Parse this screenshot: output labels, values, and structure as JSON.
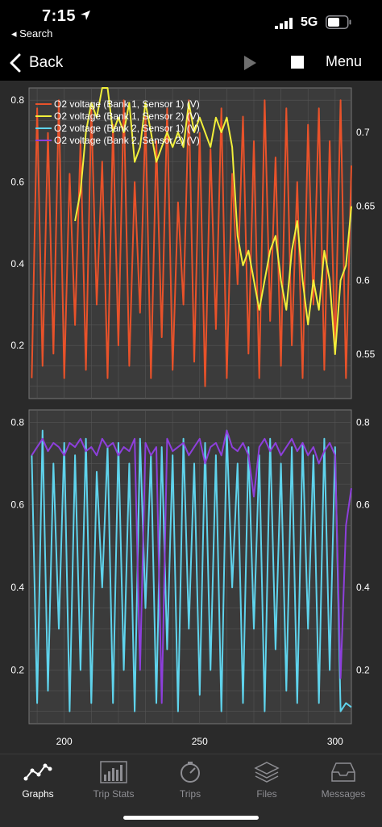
{
  "status_bar": {
    "time": "7:15",
    "back_app": "◂ Search",
    "network": "5G"
  },
  "nav": {
    "back_label": "Back",
    "menu_label": "Menu"
  },
  "colors": {
    "b1s1": "#e8522a",
    "b1s2": "#f1ef3a",
    "b2s1": "#5fd3ec",
    "b2s2": "#8d3fdb",
    "background": "#2a2a2a",
    "grid": "#555555"
  },
  "chart_data": [
    {
      "type": "line",
      "x_ticks": [
        "200",
        "250",
        "300"
      ],
      "xlim": [
        187,
        306
      ],
      "left_axis": {
        "ylim": [
          0.07,
          0.83
        ],
        "ticks": [
          "0.2",
          "0.4",
          "0.6",
          "0.8"
        ]
      },
      "right_axis": {
        "ylim": [
          0.52,
          0.73
        ],
        "ticks": [
          "0.55",
          "0.6",
          "0.65",
          "0.7"
        ]
      },
      "legend": [
        "O2 voltage (Bank 1, Sensor 1) (V)",
        "O2 voltage (Bank 1, Sensor 2) (V)",
        "O2 voltage (Bank 2, Sensor 1) (V)",
        "O2 voltage (Bank 2, Sensor 2) (V)"
      ],
      "series": [
        {
          "name": "O2 voltage (Bank 1, Sensor 1) (V)",
          "axis": "left",
          "x": [
            188,
            190,
            192,
            194,
            196,
            198,
            200,
            202,
            204,
            206,
            208,
            210,
            212,
            214,
            216,
            218,
            220,
            222,
            224,
            226,
            228,
            230,
            232,
            234,
            236,
            238,
            240,
            242,
            244,
            246,
            248,
            250,
            252,
            254,
            256,
            258,
            260,
            262,
            264,
            266,
            268,
            270,
            272,
            274,
            276,
            278,
            280,
            282,
            284,
            286,
            288,
            290,
            292,
            294,
            296,
            298,
            300,
            302,
            304,
            306
          ],
          "values": [
            0.12,
            0.78,
            0.15,
            0.72,
            0.18,
            0.8,
            0.12,
            0.62,
            0.25,
            0.7,
            0.14,
            0.78,
            0.3,
            0.65,
            0.12,
            0.74,
            0.2,
            0.8,
            0.15,
            0.6,
            0.28,
            0.76,
            0.12,
            0.7,
            0.22,
            0.78,
            0.14,
            0.55,
            0.3,
            0.8,
            0.16,
            0.72,
            0.1,
            0.68,
            0.24,
            0.78,
            0.12,
            0.62,
            0.35,
            0.76,
            0.18,
            0.7,
            0.12,
            0.8,
            0.26,
            0.66,
            0.15,
            0.78,
            0.2,
            0.6,
            0.12,
            0.74,
            0.3,
            0.78,
            0.14,
            0.7,
            0.18,
            0.8,
            0.12,
            0.64
          ]
        },
        {
          "name": "O2 voltage (Bank 1, Sensor 2) (V)",
          "axis": "right",
          "x": [
            204,
            206,
            208,
            210,
            212,
            214,
            216,
            218,
            220,
            222,
            224,
            226,
            228,
            230,
            232,
            234,
            236,
            238,
            240,
            242,
            244,
            246,
            248,
            250,
            252,
            254,
            256,
            258,
            260,
            262,
            264,
            266,
            268,
            270,
            272,
            274,
            276,
            278,
            280,
            282,
            284,
            286,
            288,
            290,
            292,
            294,
            296,
            298,
            300,
            302,
            304,
            306
          ],
          "values": [
            0.64,
            0.66,
            0.7,
            0.72,
            0.71,
            0.73,
            0.73,
            0.7,
            0.71,
            0.7,
            0.72,
            0.68,
            0.69,
            0.72,
            0.7,
            0.68,
            0.69,
            0.7,
            0.69,
            0.7,
            0.69,
            0.72,
            0.7,
            0.71,
            0.7,
            0.69,
            0.71,
            0.7,
            0.71,
            0.69,
            0.63,
            0.61,
            0.62,
            0.6,
            0.58,
            0.6,
            0.62,
            0.63,
            0.6,
            0.58,
            0.62,
            0.64,
            0.6,
            0.57,
            0.6,
            0.58,
            0.62,
            0.6,
            0.55,
            0.6,
            0.61,
            0.65
          ]
        },
        {
          "name": "O2 voltage (Bank 2, Sensor 1) (V)",
          "axis": "left",
          "x": [
            188,
            190,
            192,
            194,
            196,
            198,
            200,
            202,
            204,
            206,
            208,
            210,
            212,
            214,
            216,
            218,
            220,
            222,
            224,
            226,
            228,
            230,
            232,
            234,
            236,
            238,
            240,
            242,
            244,
            246,
            248,
            250,
            252,
            254,
            256,
            258,
            260,
            262,
            264,
            266,
            268,
            270,
            272,
            274,
            276,
            278,
            280,
            282,
            284,
            286,
            288,
            290,
            292,
            294,
            296,
            298,
            300,
            302,
            304,
            306
          ],
          "values": [
            0.72,
            0.12,
            0.78,
            0.15,
            0.7,
            0.3,
            0.75,
            0.1,
            0.72,
            0.2,
            0.76,
            0.12,
            0.68,
            0.4,
            0.74,
            0.12,
            0.75,
            0.2,
            0.7,
            0.1,
            0.76,
            0.35,
            0.72,
            0.12,
            0.74,
            0.25,
            0.72,
            0.1,
            0.76,
            0.3,
            0.7,
            0.14,
            0.75,
            0.2,
            0.72,
            0.1,
            0.78,
            0.4,
            0.7,
            0.12,
            0.74,
            0.3,
            0.72,
            0.1,
            0.76,
            0.25,
            0.7,
            0.15,
            0.74,
            0.12,
            0.75,
            0.3,
            0.72,
            0.12,
            0.76,
            0.2,
            0.74,
            0.1,
            0.12,
            0.11
          ]
        },
        {
          "name": "O2 voltage (Bank 2, Sensor 2) (V)",
          "axis": "left",
          "x": [
            188,
            190,
            192,
            194,
            196,
            198,
            200,
            202,
            204,
            206,
            208,
            210,
            212,
            214,
            216,
            218,
            220,
            222,
            224,
            226,
            228,
            230,
            232,
            234,
            236,
            238,
            240,
            242,
            244,
            246,
            248,
            250,
            252,
            254,
            256,
            258,
            260,
            262,
            264,
            266,
            268,
            270,
            272,
            274,
            276,
            278,
            280,
            282,
            284,
            286,
            288,
            290,
            292,
            294,
            296,
            298,
            300,
            302,
            304,
            306
          ],
          "values": [
            0.72,
            0.74,
            0.76,
            0.73,
            0.75,
            0.74,
            0.72,
            0.75,
            0.74,
            0.76,
            0.73,
            0.74,
            0.72,
            0.76,
            0.74,
            0.75,
            0.72,
            0.74,
            0.73,
            0.76,
            0.2,
            0.75,
            0.72,
            0.74,
            0.12,
            0.76,
            0.73,
            0.74,
            0.75,
            0.72,
            0.74,
            0.76,
            0.7,
            0.74,
            0.75,
            0.72,
            0.78,
            0.74,
            0.73,
            0.75,
            0.72,
            0.62,
            0.74,
            0.76,
            0.73,
            0.75,
            0.72,
            0.74,
            0.76,
            0.73,
            0.75,
            0.72,
            0.74,
            0.7,
            0.73,
            0.75,
            0.72,
            0.18,
            0.55,
            0.64
          ]
        }
      ]
    },
    {
      "type": "line",
      "x_ticks": [
        "200",
        "250",
        "300"
      ],
      "xlim": [
        187,
        306
      ],
      "left_axis": {
        "ylim": [
          0.07,
          0.83
        ],
        "ticks": [
          "0.2",
          "0.4",
          "0.6",
          "0.8"
        ]
      },
      "right_axis": {
        "ylim": [
          0.07,
          0.83
        ],
        "ticks": [
          "0.2",
          "0.4",
          "0.6",
          "0.8"
        ]
      }
    }
  ],
  "tabs": [
    {
      "label": "Graphs",
      "icon": "graph-icon",
      "active": true
    },
    {
      "label": "Trip Stats",
      "icon": "bar-chart-icon",
      "active": false
    },
    {
      "label": "Trips",
      "icon": "gauge-icon",
      "active": false
    },
    {
      "label": "Files",
      "icon": "layers-icon",
      "active": false
    },
    {
      "label": "Messages",
      "icon": "inbox-icon",
      "active": false
    }
  ]
}
